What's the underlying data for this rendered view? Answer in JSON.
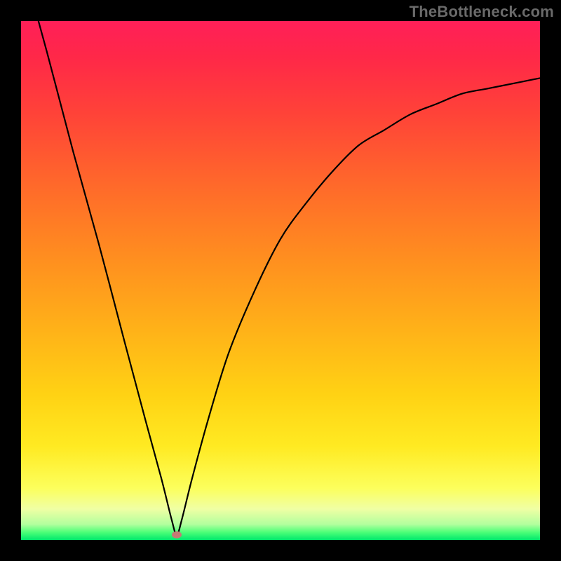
{
  "watermark": "TheBottleneck.com",
  "colors": {
    "background": "#000000",
    "gradient_top": "#ff1f58",
    "gradient_bottom": "#00e86c",
    "curve": "#000000",
    "dot": "#c47b75"
  },
  "chart_data": {
    "type": "line",
    "title": "",
    "xlabel": "",
    "ylabel": "",
    "xlim": [
      0,
      100
    ],
    "ylim": [
      0,
      100
    ],
    "grid": false,
    "legend": false,
    "optimum_x": 30,
    "series": [
      {
        "name": "bottleneck-curve",
        "x": [
          0,
          5,
          10,
          15,
          20,
          24,
          27,
          29,
          30,
          31,
          33,
          36,
          40,
          45,
          50,
          55,
          60,
          65,
          70,
          75,
          80,
          85,
          90,
          95,
          100
        ],
        "y": [
          112,
          94,
          75,
          57,
          38,
          23,
          12,
          4,
          1,
          4,
          12,
          23,
          36,
          48,
          58,
          65,
          71,
          76,
          79,
          82,
          84,
          86,
          87,
          88,
          89
        ]
      }
    ],
    "marker": {
      "x": 30,
      "y": 1,
      "shape": "ellipse"
    },
    "background_gradient_stops": [
      {
        "pos": 0.0,
        "color": "#ff1f58"
      },
      {
        "pos": 0.07,
        "color": "#ff2848"
      },
      {
        "pos": 0.18,
        "color": "#ff4338"
      },
      {
        "pos": 0.32,
        "color": "#ff6a2a"
      },
      {
        "pos": 0.46,
        "color": "#ff8f1f"
      },
      {
        "pos": 0.6,
        "color": "#ffb318"
      },
      {
        "pos": 0.72,
        "color": "#ffd214"
      },
      {
        "pos": 0.82,
        "color": "#ffea22"
      },
      {
        "pos": 0.9,
        "color": "#fcff5c"
      },
      {
        "pos": 0.94,
        "color": "#f0ffa4"
      },
      {
        "pos": 0.97,
        "color": "#b2ff9e"
      },
      {
        "pos": 0.985,
        "color": "#4dff78"
      },
      {
        "pos": 1.0,
        "color": "#00e86c"
      }
    ]
  }
}
